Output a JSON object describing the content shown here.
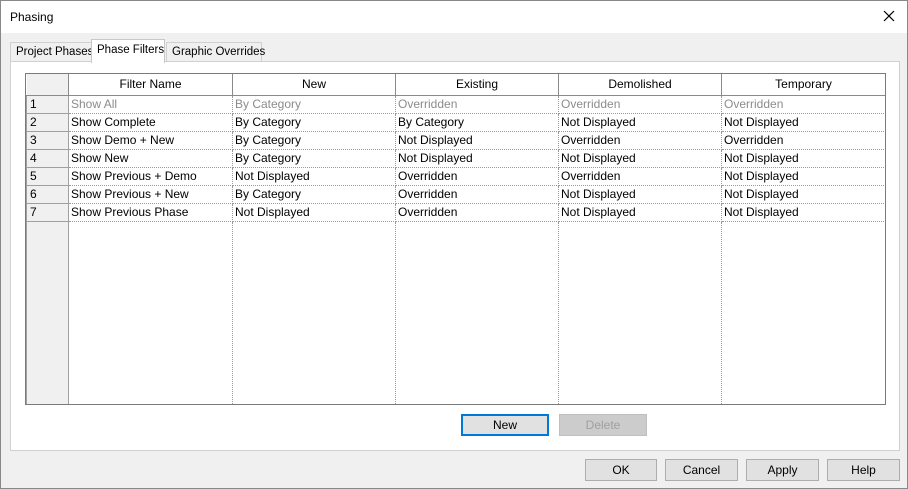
{
  "window": {
    "title": "Phasing"
  },
  "tabs": [
    {
      "label": "Project Phases"
    },
    {
      "label": "Phase Filters"
    },
    {
      "label": "Graphic Overrides"
    }
  ],
  "table": {
    "columns": [
      "Filter Name",
      "New",
      "Existing",
      "Demolished",
      "Temporary"
    ],
    "rows": [
      {
        "num": "1",
        "cells": [
          "Show All",
          "By Category",
          "Overridden",
          "Overridden",
          "Overridden"
        ]
      },
      {
        "num": "2",
        "cells": [
          "Show Complete",
          "By Category",
          "By Category",
          "Not Displayed",
          "Not Displayed"
        ]
      },
      {
        "num": "3",
        "cells": [
          "Show Demo + New",
          "By Category",
          "Not Displayed",
          "Overridden",
          "Overridden"
        ]
      },
      {
        "num": "4",
        "cells": [
          "Show New",
          "By Category",
          "Not Displayed",
          "Not Displayed",
          "Not Displayed"
        ]
      },
      {
        "num": "5",
        "cells": [
          "Show Previous + Demo",
          "Not Displayed",
          "Overridden",
          "Overridden",
          "Not Displayed"
        ]
      },
      {
        "num": "6",
        "cells": [
          "Show Previous + New",
          "By Category",
          "Overridden",
          "Not Displayed",
          "Not Displayed"
        ]
      },
      {
        "num": "7",
        "cells": [
          "Show Previous Phase",
          "Not Displayed",
          "Overridden",
          "Not Displayed",
          "Not Displayed"
        ]
      }
    ]
  },
  "panel_buttons": {
    "new": "New",
    "delete": "Delete"
  },
  "footer_buttons": {
    "ok": "OK",
    "cancel": "Cancel",
    "apply": "Apply",
    "help": "Help"
  }
}
